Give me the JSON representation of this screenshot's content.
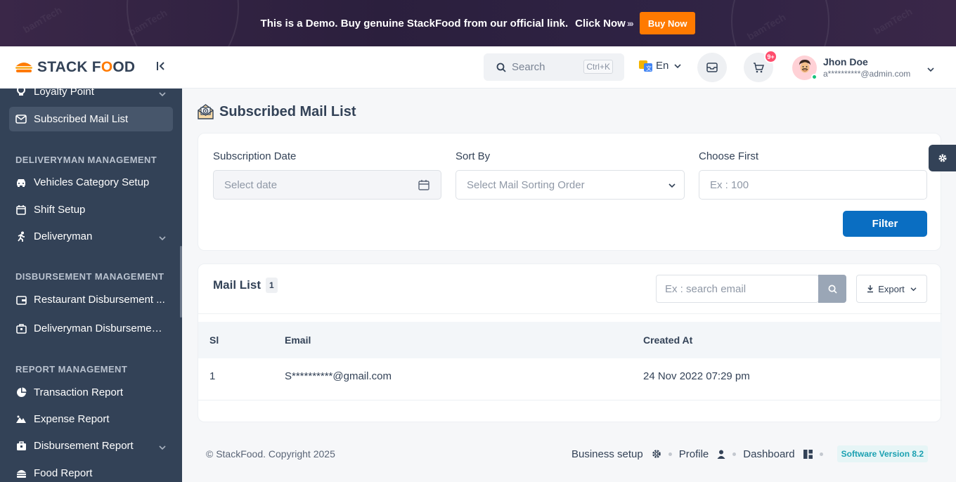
{
  "banner": {
    "text": "This is a Demo. Buy genuine StackFood from our official link.",
    "link": "Click Now",
    "arrows": "›››",
    "buy_label": "Buy Now",
    "watermarks": [
      "bamTech",
      "bamTech",
      "bamTech",
      "bamTech"
    ]
  },
  "brand": {
    "logo_text_part1": "STACK F",
    "logo_text_o": "O",
    "logo_text_part2": "OD"
  },
  "sidebar": {
    "items": [
      {
        "label": "Loyalty Point",
        "icon": "bulb-icon",
        "has_chevron": true
      },
      {
        "label": "Subscribed Mail List",
        "icon": "mail-icon",
        "active": true
      },
      {
        "label": "Vehicles Category Setup",
        "icon": "car-icon"
      },
      {
        "label": "Shift Setup",
        "icon": "calendar-icon"
      },
      {
        "label": "Deliveryman",
        "icon": "running-icon",
        "has_chevron": true
      },
      {
        "label": "Restaurant Disbursement ...",
        "icon": "wallet-icon"
      },
      {
        "label": "Deliveryman Disbursement...",
        "icon": "bag-wallet-icon"
      },
      {
        "label": "Transaction Report",
        "icon": "pie-icon"
      },
      {
        "label": "Expense Report",
        "icon": "mountain-icon"
      },
      {
        "label": "Disbursement Report",
        "icon": "report-icon",
        "has_chevron": true
      },
      {
        "label": "Food Report",
        "icon": "burger-icon"
      }
    ],
    "sections": [
      "DELIVERYMAN MANAGEMENT",
      "DISBURSEMENT MANAGEMENT",
      "REPORT MANAGEMENT"
    ]
  },
  "header": {
    "search_placeholder": "Search",
    "search_shortcut": "Ctrl+K",
    "language": "En",
    "cart_badge": "9+",
    "user_name": "Jhon Doe",
    "user_email": "a**********@admin.com"
  },
  "page": {
    "title": "Subscribed Mail List"
  },
  "filters": {
    "subscription_date_label": "Subscription Date",
    "subscription_date_placeholder": "Select date",
    "sort_by_label": "Sort By",
    "sort_by_placeholder": "Select Mail Sorting Order",
    "choose_first_label": "Choose First",
    "choose_first_placeholder": "Ex : 100",
    "filter_button": "Filter"
  },
  "mail_list": {
    "title": "Mail List",
    "count": "1",
    "search_placeholder": "Ex : search email",
    "export_label": "Export",
    "columns": [
      "Sl",
      "Email",
      "Created At"
    ],
    "rows": [
      {
        "sl": "1",
        "email": "S**********@gmail.com",
        "created_at": "24 Nov 2022 07:29 pm"
      }
    ]
  },
  "footer": {
    "copyright": "© StackFood. Copyright 2025",
    "links": [
      "Business setup",
      "Profile",
      "Dashboard"
    ],
    "version": "Software Version 8.2"
  },
  "colors": {
    "sidebar_bg": "#334257",
    "primary_button": "#0a6ec2",
    "buy_button": "#ff7a00",
    "cart_badge": "#ff4d6d",
    "version_text": "#1aa0b1"
  }
}
